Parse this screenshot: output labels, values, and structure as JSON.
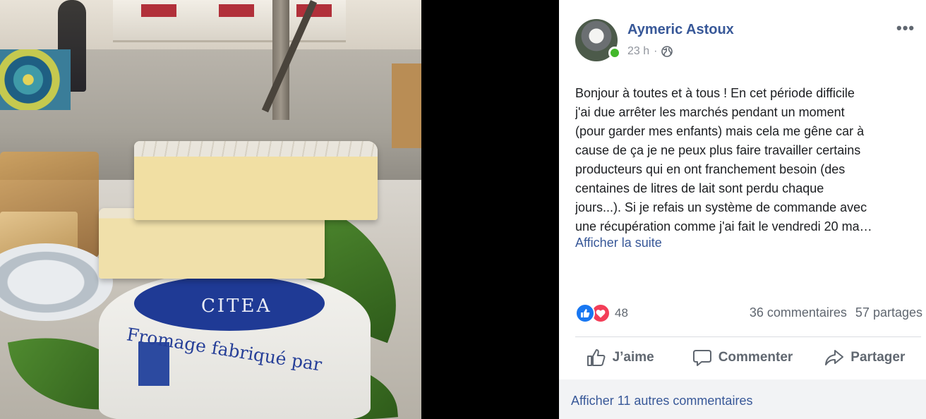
{
  "post": {
    "author": "Aymeric Astoux",
    "timestamp": "23 h",
    "separator": "·",
    "privacy_icon": "globe-icon",
    "more_icon": "more-options-icon",
    "more_label": "•••",
    "body_lines": [
      "Bonjour à toutes et à tous ! En cet période difficile",
      "j'ai due arrêter les marchés pendant un moment",
      "(pour garder mes enfants) mais cela me gêne car à",
      "cause de ça je ne peux plus faire travailler certains",
      "producteurs qui en ont franchement besoin (des",
      "centaines de litres de lait sont perdu chaque",
      "jours...). Si je refais un système de commande avec",
      "une récupération comme j'ai fait le vendredi 20 ma…"
    ],
    "see_more": "Afficher la suite"
  },
  "photo": {
    "seal_text": "CITEA",
    "script_text": "Fromage fabriqué par"
  },
  "reactions": {
    "types": [
      "like",
      "love"
    ],
    "count": "48",
    "comments": "36 commentaires",
    "shares": "57 partages"
  },
  "actions": {
    "like": "J’aime",
    "comment": "Commenter",
    "share": "Partager"
  },
  "comments": {
    "view_more": "Afficher 11 autres commentaires"
  },
  "colors": {
    "link": "#385898",
    "like_blue": "#1877f2",
    "love_red": "#f33e58",
    "online_green": "#42b72a",
    "muted": "#606770"
  }
}
